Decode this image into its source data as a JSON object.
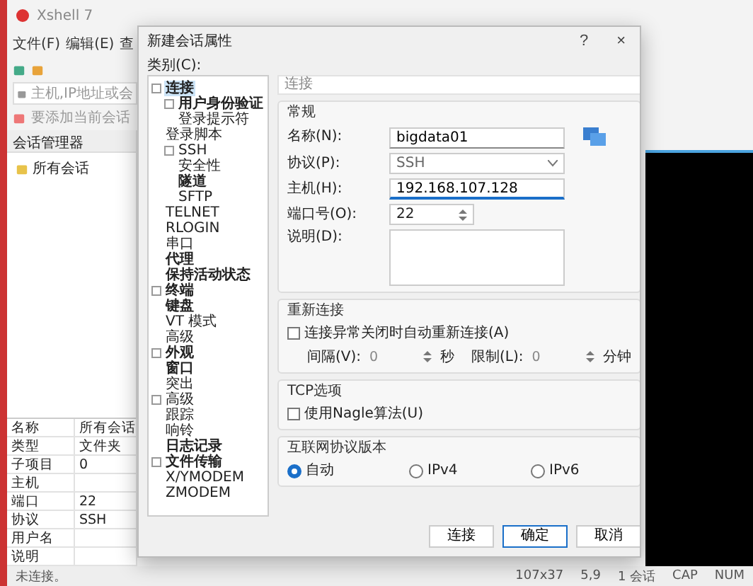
{
  "app": {
    "title": "Xshell 7",
    "menu": [
      "文件(F)",
      "编辑(E)",
      "查"
    ],
    "address_placeholder": "主机,IP地址或会",
    "session_hint": "要添加当前会话",
    "panel_title": "会话管理器",
    "sessions": [
      {
        "label": "所有会话"
      }
    ],
    "properties": [
      {
        "name": "名称",
        "value": "所有会话"
      },
      {
        "name": "类型",
        "value": "文件夹"
      },
      {
        "name": "子项目",
        "value": "0"
      },
      {
        "name": "主机"
      },
      {
        "name": "端口",
        "value": "22"
      },
      {
        "name": "协议",
        "value": "SSH"
      },
      {
        "name": "用户名"
      },
      {
        "name": "说明"
      }
    ],
    "status": "未连接。",
    "status_bar": [
      "107x37",
      "5,9",
      "1 会话",
      "CAP",
      "NUM"
    ]
  },
  "dialog": {
    "title": "新建会话属性",
    "help": "?",
    "close": "×",
    "category_label": "类别(C):",
    "categories": [
      {
        "label": "连接",
        "bold": true,
        "selected": true,
        "children": [
          {
            "label": "用户身份验证",
            "bold": true,
            "selected": false,
            "children": [
              {
                "label": "登录提示符",
                "bold": false,
                "selected": false
              }
            ]
          },
          {
            "label": "登录脚本",
            "bold": false,
            "selected": false
          },
          {
            "label": "SSH",
            "bold": false,
            "selected": false,
            "children": [
              {
                "label": "安全性",
                "bold": false,
                "selected": false
              },
              {
                "label": "隧道",
                "bold": true,
                "selected": false
              },
              {
                "label": "SFTP",
                "bold": false,
                "selected": false
              }
            ]
          },
          {
            "label": "TELNET",
            "bold": false,
            "selected": false
          },
          {
            "label": "RLOGIN",
            "bold": false,
            "selected": false
          },
          {
            "label": "串口",
            "bold": false,
            "selected": false
          },
          {
            "label": "代理",
            "bold": true,
            "selected": false
          },
          {
            "label": "保持活动状态",
            "bold": true,
            "selected": false
          }
        ]
      },
      {
        "label": "终端",
        "bold": true,
        "selected": false,
        "children": [
          {
            "label": "键盘",
            "bold": true,
            "selected": false
          },
          {
            "label": "VT 模式",
            "bold": false,
            "selected": false
          },
          {
            "label": "高级",
            "bold": false,
            "selected": false
          }
        ]
      },
      {
        "label": "外观",
        "bold": true,
        "selected": false,
        "children": [
          {
            "label": "窗口",
            "bold": true,
            "selected": false
          },
          {
            "label": "突出",
            "bold": false,
            "selected": false
          }
        ]
      },
      {
        "label": "高级",
        "bold": false,
        "selected": false,
        "children": [
          {
            "label": "跟踪",
            "bold": false,
            "selected": false
          },
          {
            "label": "响铃",
            "bold": false,
            "selected": false
          },
          {
            "label": "日志记录",
            "bold": true,
            "selected": false
          }
        ]
      },
      {
        "label": "文件传输",
        "bold": true,
        "selected": false,
        "children": [
          {
            "label": "X/YMODEM",
            "bold": false,
            "selected": false
          },
          {
            "label": "ZMODEM",
            "bold": false,
            "selected": false
          }
        ]
      }
    ],
    "section_title": "连接",
    "general": {
      "title": "常规",
      "name_label": "名称(N):",
      "name": "bigdata01",
      "protocol_label": "协议(P):",
      "protocol": "SSH",
      "host_label": "主机(H):",
      "host": "192.168.107.128",
      "port_label": "端口号(O):",
      "port": "22",
      "desc_label": "说明(D):"
    },
    "reconnect": {
      "title": "重新连接",
      "checkbox": "连接异常关闭时自动重新连接(A)",
      "checked": false,
      "interval_label": "间隔(V):",
      "interval": "0",
      "interval_unit": "秒",
      "limit_label": "限制(L):",
      "limit": "0",
      "limit_unit": "分钟"
    },
    "tcp": {
      "title": "TCP选项",
      "checkbox": "使用Nagle算法(U)",
      "checked": false
    },
    "ip_version": {
      "title": "互联网协议版本",
      "options": [
        {
          "label": "自动",
          "selected": true
        },
        {
          "label": "IPv4",
          "selected": false
        },
        {
          "label": "IPv6",
          "selected": false
        }
      ]
    },
    "buttons": [
      {
        "label": "连接",
        "default": false
      },
      {
        "label": "确定",
        "default": true
      },
      {
        "label": "取消",
        "default": false
      }
    ]
  }
}
